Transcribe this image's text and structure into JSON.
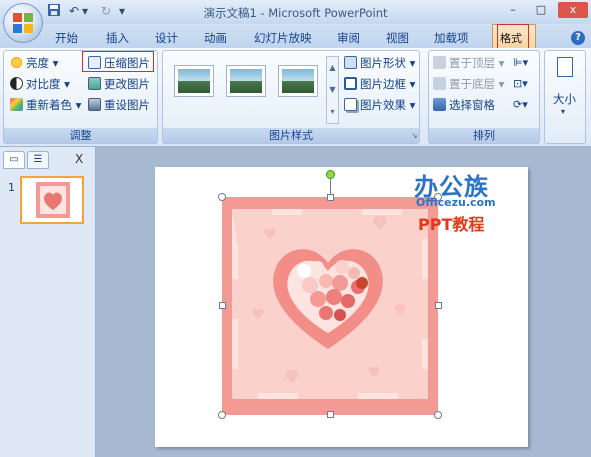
{
  "window": {
    "title": "演示文稿1 - Microsoft PowerPoint",
    "minimize": "–",
    "maximize": "□",
    "close": "x"
  },
  "quick_access": {
    "undo": "↶",
    "redo": "↻",
    "dropdown": "▾"
  },
  "tabs": [
    {
      "label": "开始"
    },
    {
      "label": "插入"
    },
    {
      "label": "设计"
    },
    {
      "label": "动画"
    },
    {
      "label": "幻灯片放映"
    },
    {
      "label": "审阅"
    },
    {
      "label": "视图"
    },
    {
      "label": "加载项"
    }
  ],
  "active_tab": "格式",
  "help": "?",
  "groups": {
    "adjust": {
      "label": "调整",
      "brightness": "亮度 ▾",
      "contrast": "对比度 ▾",
      "recolor": "重新着色 ▾",
      "compress": "压缩图片",
      "change": "更改图片",
      "reset": "重设图片"
    },
    "styles": {
      "label": "图片样式",
      "shape": "图片形状 ▾",
      "border": "图片边框 ▾",
      "effects": "图片效果 ▾"
    },
    "arrange": {
      "label": "排列",
      "to_front": "置于顶层 ▾",
      "to_back": "置于底层 ▾",
      "selection_pane": "选择窗格"
    },
    "size": {
      "label": "大小"
    }
  },
  "slides_pane": {
    "slide_number": "1",
    "close": "X"
  },
  "watermark": {
    "logo": "办公族",
    "url": "Officezu.com",
    "subtitle": "PPT教程"
  },
  "colors": {
    "ribbon_bg": "#dbe7f6",
    "highlight_red": "#d03030",
    "active_tab": "#f8d3a3",
    "picture_border": "#f08a84",
    "picture_inner": "#fce3df",
    "heart_dark": "#e9706f"
  }
}
